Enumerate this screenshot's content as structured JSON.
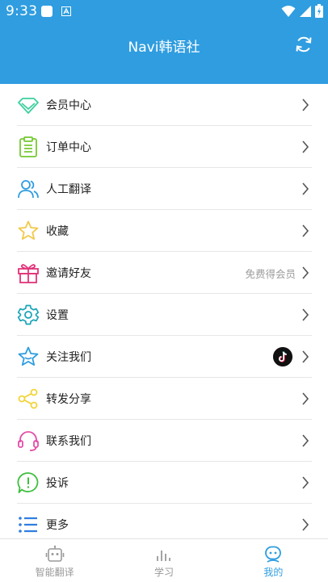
{
  "status_bar": {
    "time": "9:33"
  },
  "header": {
    "title": "Navi韩语社"
  },
  "menu": {
    "items": [
      {
        "label": "会员中心",
        "icon": "diamond-icon",
        "extra": ""
      },
      {
        "label": "订单中心",
        "icon": "clipboard-icon",
        "extra": ""
      },
      {
        "label": "人工翻译",
        "icon": "users-icon",
        "extra": ""
      },
      {
        "label": "收藏",
        "icon": "star-icon",
        "extra": ""
      },
      {
        "label": "邀请好友",
        "icon": "gift-icon",
        "extra": "免费得会员"
      },
      {
        "label": "设置",
        "icon": "gear-icon",
        "extra": ""
      },
      {
        "label": "关注我们",
        "icon": "star-badge-icon",
        "extra": ""
      },
      {
        "label": "转发分享",
        "icon": "share-icon",
        "extra": ""
      },
      {
        "label": "联系我们",
        "icon": "headset-icon",
        "extra": ""
      },
      {
        "label": "投诉",
        "icon": "exclamation-bubble-icon",
        "extra": ""
      },
      {
        "label": "更多",
        "icon": "list-icon",
        "extra": ""
      }
    ]
  },
  "tab_bar": {
    "tabs": [
      {
        "label": "智能翻译",
        "icon": "robot-icon",
        "active": false
      },
      {
        "label": "学习",
        "icon": "bars-icon",
        "active": false
      },
      {
        "label": "我的",
        "icon": "face-icon",
        "active": true
      }
    ]
  },
  "colors": {
    "header": "#2f9de0",
    "accent": "#2f9de0",
    "diamond": "#3ccf9d",
    "clipboard": "#76c930",
    "users": "#2f9de0",
    "star": "#f2c94c",
    "gift": "#e2337a",
    "gear": "#1aa5b8",
    "star_badge": "#2f9de0",
    "share": "#f2d43d",
    "headset": "#e24fa8",
    "exclamation": "#3fbf3f",
    "list": "#2f7fe0"
  }
}
